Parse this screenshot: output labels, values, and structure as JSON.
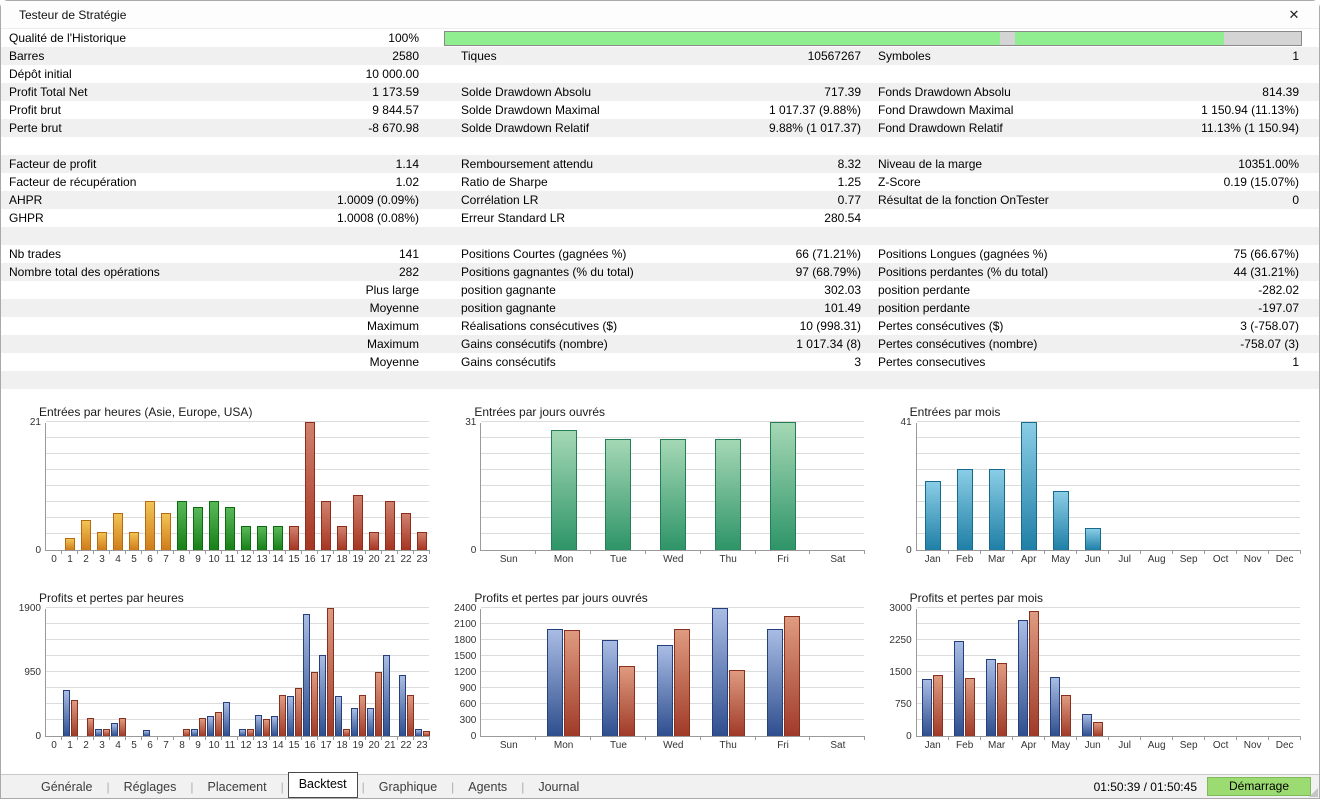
{
  "window": {
    "title": "Testeur de Stratégie",
    "close_icon": "✕"
  },
  "stats": {
    "rows": [
      {
        "bg": "w",
        "progress": true,
        "cells": [
          [
            "Qualité de l'Historique",
            "100%"
          ]
        ]
      },
      {
        "bg": "g",
        "cells": [
          [
            "Barres",
            "2580"
          ],
          [
            "Tiques",
            "10567267"
          ],
          [
            "Symboles",
            "1"
          ]
        ]
      },
      {
        "bg": "w",
        "cells": [
          [
            "Dépôt initial",
            "10 000.00"
          ],
          [
            "",
            ""
          ],
          [
            "",
            ""
          ]
        ]
      },
      {
        "bg": "g",
        "cells": [
          [
            "Profit Total Net",
            "1 173.59"
          ],
          [
            "Solde Drawdown Absolu",
            "717.39"
          ],
          [
            "Fonds Drawdown Absolu",
            "814.39"
          ]
        ]
      },
      {
        "bg": "w",
        "cells": [
          [
            "Profit brut",
            "9 844.57"
          ],
          [
            "Solde Drawdown Maximal",
            "1 017.37 (9.88%)"
          ],
          [
            "Fond Drawdown Maximal",
            "1 150.94 (11.13%)"
          ]
        ]
      },
      {
        "bg": "g",
        "cells": [
          [
            "Perte brut",
            "-8 670.98"
          ],
          [
            "Solde Drawdown Relatif",
            "9.88% (1 017.37)"
          ],
          [
            "Fond Drawdown Relatif",
            "11.13% (1 150.94)"
          ]
        ]
      },
      {
        "bg": "w",
        "cells": [
          [
            "",
            ""
          ],
          [
            "",
            ""
          ],
          [
            "",
            ""
          ]
        ]
      },
      {
        "bg": "g",
        "cells": [
          [
            "Facteur de profit",
            "1.14"
          ],
          [
            "Remboursement attendu",
            "8.32"
          ],
          [
            "Niveau de la marge",
            "10351.00%"
          ]
        ]
      },
      {
        "bg": "w",
        "cells": [
          [
            "Facteur de récupération",
            "1.02"
          ],
          [
            "Ratio de Sharpe",
            "1.25"
          ],
          [
            "Z-Score",
            "0.19 (15.07%)"
          ]
        ]
      },
      {
        "bg": "g",
        "cells": [
          [
            "AHPR",
            "1.0009 (0.09%)"
          ],
          [
            "Corrélation LR",
            "0.77"
          ],
          [
            "Résultat de la fonction OnTester",
            "0"
          ]
        ]
      },
      {
        "bg": "w",
        "cells": [
          [
            "GHPR",
            "1.0008 (0.08%)"
          ],
          [
            "Erreur Standard LR",
            "280.54"
          ],
          [
            "",
            ""
          ]
        ]
      },
      {
        "bg": "g",
        "cells": [
          [
            "",
            ""
          ],
          [
            "",
            ""
          ],
          [
            "",
            ""
          ]
        ]
      },
      {
        "bg": "w",
        "cells": [
          [
            "Nb trades",
            "141"
          ],
          [
            "Positions Courtes (gagnées %)",
            "66 (71.21%)"
          ],
          [
            "Positions Longues (gagnées %)",
            "75 (66.67%)"
          ]
        ]
      },
      {
        "bg": "g",
        "cells": [
          [
            "Nombre total des opérations",
            "282"
          ],
          [
            "Positions gagnantes (% du total)",
            "97 (68.79%)"
          ],
          [
            "Positions perdantes (% du total)",
            "44 (31.21%)"
          ]
        ]
      },
      {
        "bg": "w",
        "cells": [
          [
            "",
            "Plus large"
          ],
          [
            "position gagnante",
            "302.03"
          ],
          [
            "position perdante",
            "-282.02"
          ]
        ]
      },
      {
        "bg": "g",
        "cells": [
          [
            "",
            "Moyenne"
          ],
          [
            "position gagnante",
            "101.49"
          ],
          [
            "position perdante",
            "-197.07"
          ]
        ]
      },
      {
        "bg": "w",
        "cells": [
          [
            "",
            "Maximum"
          ],
          [
            "Réalisations consécutives ($)",
            "10 (998.31)"
          ],
          [
            "Pertes consécutives ($)",
            "3 (-758.07)"
          ]
        ]
      },
      {
        "bg": "g",
        "cells": [
          [
            "",
            "Maximum"
          ],
          [
            "Gains consécutifs (nombre)",
            "1 017.34 (8)"
          ],
          [
            "Pertes consécutives (nombre)",
            "-758.07 (3)"
          ]
        ]
      },
      {
        "bg": "w",
        "cells": [
          [
            "",
            "Moyenne"
          ],
          [
            "Gains consécutifs",
            "3"
          ],
          [
            "Pertes consecutives",
            "1"
          ]
        ]
      },
      {
        "bg": "g",
        "cells": [
          [
            "",
            ""
          ],
          [
            "",
            ""
          ],
          [
            "",
            ""
          ]
        ]
      }
    ]
  },
  "progress": {
    "segments": [
      {
        "c": "#90ee90",
        "w": 64.8
      },
      {
        "c": "#d4d4d4",
        "w": 1.8
      },
      {
        "c": "#90ee90",
        "w": 24.4
      },
      {
        "c": "#d4d4d4",
        "w": 9.0
      }
    ]
  },
  "palettes": {
    "asia": [
      "#f2c455",
      "#d07c18",
      "#b36a12"
    ],
    "europe": [
      "#58b858",
      "#178017",
      "#0f6a0f"
    ],
    "usa": [
      "#d0816e",
      "#a63422",
      "#8e2b1b"
    ],
    "day_green": [
      "#a5d8b5",
      "#2e9468",
      "#237e56"
    ],
    "month_blue": [
      "#8acde6",
      "#1f7fa6",
      "#186a8c"
    ],
    "pnl_profit": [
      "#a9bce4",
      "#2e4e8e",
      "#24407a"
    ],
    "pnl_loss": [
      "#de9b80",
      "#a03a28",
      "#88301f"
    ]
  },
  "chart_data": [
    {
      "type": "bar",
      "title": "Entrées par heures (Asie, Europe, USA)",
      "ymax": 21,
      "ylim": [
        0,
        21
      ],
      "yticks": [
        {
          "v": 0,
          "t": "0"
        },
        {
          "v": 21,
          "t": "21"
        }
      ],
      "categories": [
        "0",
        "1",
        "2",
        "3",
        "4",
        "5",
        "6",
        "7",
        "8",
        "9",
        "10",
        "11",
        "12",
        "13",
        "14",
        "15",
        "16",
        "17",
        "18",
        "19",
        "20",
        "21",
        "22",
        "23"
      ],
      "series": [
        {
          "name": "entries",
          "values": [
            0,
            2,
            5,
            3,
            6,
            3,
            8,
            6,
            8,
            7,
            8,
            7,
            4,
            4,
            4,
            4,
            21,
            8,
            4,
            9,
            3,
            8,
            6,
            3
          ]
        }
      ],
      "bar_palettes": [
        "asia",
        "asia",
        "asia",
        "asia",
        "asia",
        "asia",
        "asia",
        "asia",
        "europe",
        "europe",
        "europe",
        "europe",
        "europe",
        "europe",
        "europe",
        "usa",
        "usa",
        "usa",
        "usa",
        "usa",
        "usa",
        "usa",
        "usa",
        "usa"
      ]
    },
    {
      "type": "bar",
      "title": "Entrées par jours ouvrés",
      "ymax": 31,
      "ylim": [
        0,
        31
      ],
      "yticks": [
        {
          "v": 0,
          "t": "0"
        },
        {
          "v": 31,
          "t": "31"
        }
      ],
      "categories": [
        "Sun",
        "Mon",
        "Tue",
        "Wed",
        "Thu",
        "Fri",
        "Sat"
      ],
      "series": [
        {
          "name": "entries",
          "palette": "day_green",
          "values": [
            0,
            29,
            27,
            27,
            27,
            31,
            0
          ]
        }
      ]
    },
    {
      "type": "bar",
      "title": "Entrées par mois",
      "ymax": 41,
      "ylim": [
        0,
        41
      ],
      "yticks": [
        {
          "v": 0,
          "t": "0"
        },
        {
          "v": 41,
          "t": "41"
        }
      ],
      "categories": [
        "Jan",
        "Feb",
        "Mar",
        "Apr",
        "May",
        "Jun",
        "Jul",
        "Aug",
        "Sep",
        "Oct",
        "Nov",
        "Dec"
      ],
      "series": [
        {
          "name": "entries",
          "palette": "month_blue",
          "values": [
            22,
            26,
            26,
            41,
            19,
            7,
            0,
            0,
            0,
            0,
            0,
            0
          ]
        }
      ]
    },
    {
      "type": "bar",
      "title": "Profits et pertes par heures",
      "ymax": 1900,
      "ylim": [
        0,
        1900
      ],
      "yticks": [
        {
          "v": 0,
          "t": "0"
        },
        {
          "v": 950,
          "t": "950"
        },
        {
          "v": 1900,
          "t": "1900"
        }
      ],
      "categories": [
        "0",
        "1",
        "2",
        "3",
        "4",
        "5",
        "6",
        "7",
        "8",
        "9",
        "10",
        "11",
        "12",
        "13",
        "14",
        "15",
        "16",
        "17",
        "18",
        "19",
        "20",
        "21",
        "22",
        "23"
      ],
      "series": [
        {
          "name": "profit",
          "palette": "pnl_profit",
          "values": [
            0,
            690,
            0,
            110,
            190,
            0,
            90,
            0,
            0,
            110,
            290,
            500,
            110,
            310,
            300,
            600,
            1810,
            1200,
            600,
            410,
            410,
            1200,
            900,
            110
          ]
        },
        {
          "name": "loss",
          "palette": "pnl_loss",
          "values": [
            0,
            540,
            260,
            110,
            260,
            0,
            0,
            0,
            110,
            260,
            350,
            0,
            110,
            250,
            610,
            710,
            950,
            1900,
            110,
            610,
            950,
            0,
            610,
            80
          ]
        }
      ]
    },
    {
      "type": "bar",
      "title": "Profits et pertes par jours ouvrés",
      "ymax": 2400,
      "ylim": [
        0,
        2400
      ],
      "yticks": [
        {
          "v": 0,
          "t": "0"
        },
        {
          "v": 300,
          "t": "300"
        },
        {
          "v": 600,
          "t": "600"
        },
        {
          "v": 900,
          "t": "900"
        },
        {
          "v": 1200,
          "t": "1200"
        },
        {
          "v": 1500,
          "t": "1500"
        },
        {
          "v": 1800,
          "t": "1800"
        },
        {
          "v": 2100,
          "t": "2100"
        },
        {
          "v": 2400,
          "t": "2400"
        }
      ],
      "categories": [
        "Sun",
        "Mon",
        "Tue",
        "Wed",
        "Thu",
        "Fri",
        "Sat"
      ],
      "series": [
        {
          "name": "profit",
          "palette": "pnl_profit",
          "values": [
            0,
            2000,
            1800,
            1700,
            2400,
            2000,
            0
          ]
        },
        {
          "name": "loss",
          "palette": "pnl_loss",
          "values": [
            0,
            1990,
            1310,
            2000,
            1240,
            2250,
            0
          ]
        }
      ]
    },
    {
      "type": "bar",
      "title": "Profits et pertes par mois",
      "ymax": 3000,
      "ylim": [
        0,
        3000
      ],
      "yticks": [
        {
          "v": 0,
          "t": "0"
        },
        {
          "v": 750,
          "t": "750"
        },
        {
          "v": 1500,
          "t": "1500"
        },
        {
          "v": 2250,
          "t": "2250"
        },
        {
          "v": 3000,
          "t": "3000"
        }
      ],
      "categories": [
        "Jan",
        "Feb",
        "Mar",
        "Apr",
        "May",
        "Jun",
        "Jul",
        "Aug",
        "Sep",
        "Oct",
        "Nov",
        "Dec"
      ],
      "series": [
        {
          "name": "profit",
          "palette": "pnl_profit",
          "values": [
            1330,
            2230,
            1810,
            2720,
            1380,
            510,
            0,
            0,
            0,
            0,
            0,
            0
          ]
        },
        {
          "name": "loss",
          "palette": "pnl_loss",
          "values": [
            1430,
            1360,
            1710,
            2940,
            970,
            340,
            0,
            0,
            0,
            0,
            0,
            0
          ]
        }
      ]
    }
  ],
  "tabs": {
    "items": [
      "Générale",
      "Réglages",
      "Placement",
      "Backtest",
      "Graphique",
      "Agents",
      "Journal"
    ],
    "active": "Backtest"
  },
  "status": {
    "elapsed": "01:50:39 / 01:50:45",
    "start_label": "Démarrage",
    "button_color": "#9cdb72"
  }
}
